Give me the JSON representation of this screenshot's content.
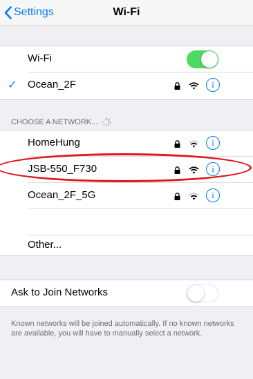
{
  "navbar": {
    "back_label": "Settings",
    "title": "Wi-Fi"
  },
  "wifi_toggle": {
    "label": "Wi-Fi",
    "on": true
  },
  "connected": {
    "name": "Ocean_2F"
  },
  "networks_header": "CHOOSE A NETWORK...",
  "networks": [
    {
      "name": "HomeHung"
    },
    {
      "name": "JSB-550_F730"
    },
    {
      "name": "Ocean_2F_5G"
    }
  ],
  "other_label": "Other...",
  "ask_join": {
    "label": "Ask to Join Networks",
    "on": false
  },
  "footer_text": "Known networks will be joined automatically. If no known networks are available, you will have to manually select a network.",
  "info_glyph": "i",
  "check_glyph": "✓",
  "icons": [
    "chevron-left-icon",
    "lock-icon",
    "wifi-icon",
    "info-icon",
    "spinner-icon"
  ],
  "colors": {
    "accent": "#007aff",
    "toggle_on": "#4cd964",
    "highlight": "#e0141c",
    "background": "#efeff4"
  }
}
